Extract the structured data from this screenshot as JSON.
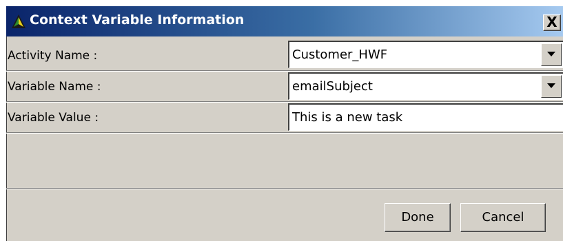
{
  "window": {
    "title": "Context Variable Information",
    "close_label": "X"
  },
  "form": {
    "activity_name": {
      "label": "Activity Name :",
      "value": "Customer_HWF"
    },
    "variable_name": {
      "label": "Variable Name :",
      "value": "emailSubject"
    },
    "variable_value": {
      "label": "Variable Value :",
      "value": "This is a new task"
    }
  },
  "buttons": {
    "done_label": "Done",
    "cancel_label": "Cancel"
  },
  "icons": {
    "app": "app-logo-icon",
    "close": "close-icon",
    "dropdown": "chevron-down-icon"
  },
  "colors": {
    "titlebar_start": "#0a246a",
    "titlebar_end": "#a6caf0",
    "dialog_face": "#d4d0c8"
  }
}
